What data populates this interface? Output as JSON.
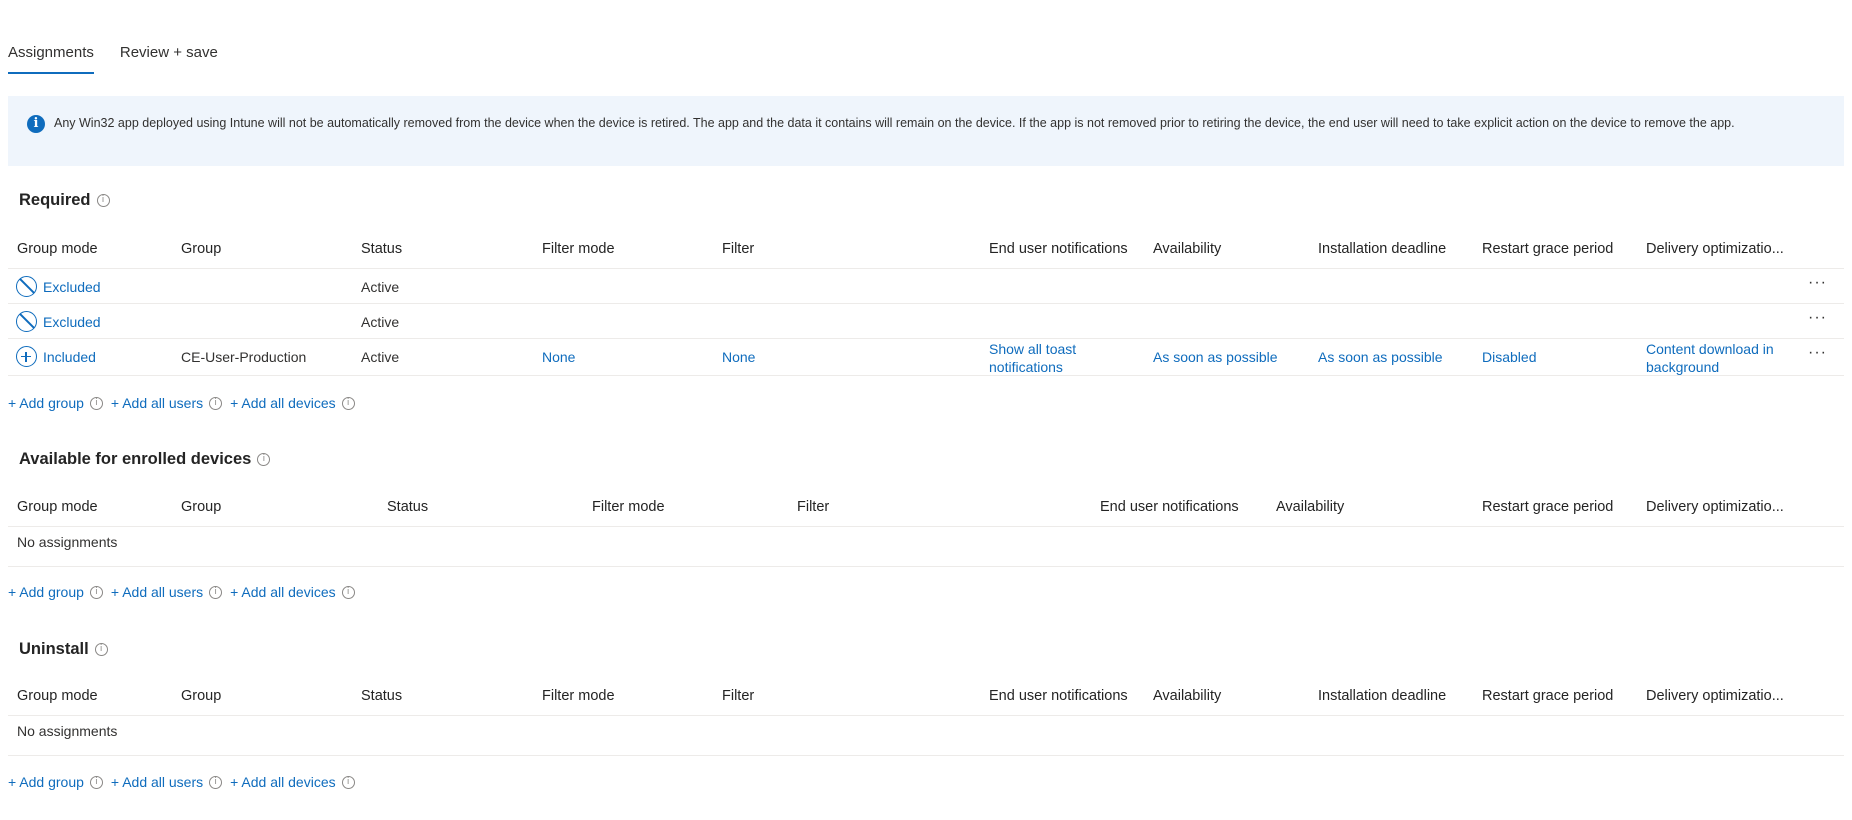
{
  "tabs": [
    {
      "label": "Assignments",
      "active": true
    },
    {
      "label": "Review + save",
      "active": false
    }
  ],
  "banner": {
    "icon": "info-icon",
    "text": "Any Win32 app deployed using Intune will not be automatically removed from the device when the device is retired. The app and the data it contains will remain on the device. If the app is not removed prior to retiring the device, the end user will need to take explicit action on the device to remove the app."
  },
  "colors": {
    "accent": "#0f6cbd",
    "banner_bg": "#eff5fc",
    "divider": "#edebe9"
  },
  "actions": {
    "add_group": "+ Add group",
    "add_all_users": "+ Add all users",
    "add_all_devices": "+ Add all devices"
  },
  "required": {
    "title": "Required",
    "columns": [
      "Group mode",
      "Group",
      "Status",
      "Filter mode",
      "Filter",
      "End user notifications",
      "Availability",
      "Installation deadline",
      "Restart grace period",
      "Delivery optimizatio..."
    ],
    "rows": [
      {
        "mode": "Excluded",
        "mode_icon": "block-icon",
        "group": "",
        "status": "Active",
        "filter_mode": "",
        "filter": "",
        "notifications": "",
        "availability": "",
        "deadline": "",
        "restart": "",
        "delivery": "",
        "more": "···"
      },
      {
        "mode": "Excluded",
        "mode_icon": "block-icon",
        "group": "",
        "status": "Active",
        "filter_mode": "",
        "filter": "",
        "notifications": "",
        "availability": "",
        "deadline": "",
        "restart": "",
        "delivery": "",
        "more": "···"
      },
      {
        "mode": "Included",
        "mode_icon": "add-circle-icon",
        "group": "CE-User-Production",
        "status": "Active",
        "filter_mode": "None",
        "filter": "None",
        "notifications": "Show all toast notifications",
        "availability": "As soon as possible",
        "deadline": "As soon as possible",
        "restart": "Disabled",
        "delivery": "Content download in background",
        "more": "···"
      }
    ]
  },
  "available": {
    "title": "Available for enrolled devices",
    "columns": [
      "Group mode",
      "Group",
      "Status",
      "Filter mode",
      "Filter",
      "End user notifications",
      "Availability",
      "Restart grace period",
      "Delivery optimizatio..."
    ],
    "empty_text": "No assignments"
  },
  "uninstall": {
    "title": "Uninstall",
    "columns": [
      "Group mode",
      "Group",
      "Status",
      "Filter mode",
      "Filter",
      "End user notifications",
      "Availability",
      "Installation deadline",
      "Restart grace period",
      "Delivery optimizatio..."
    ],
    "empty_text": "No assignments"
  }
}
